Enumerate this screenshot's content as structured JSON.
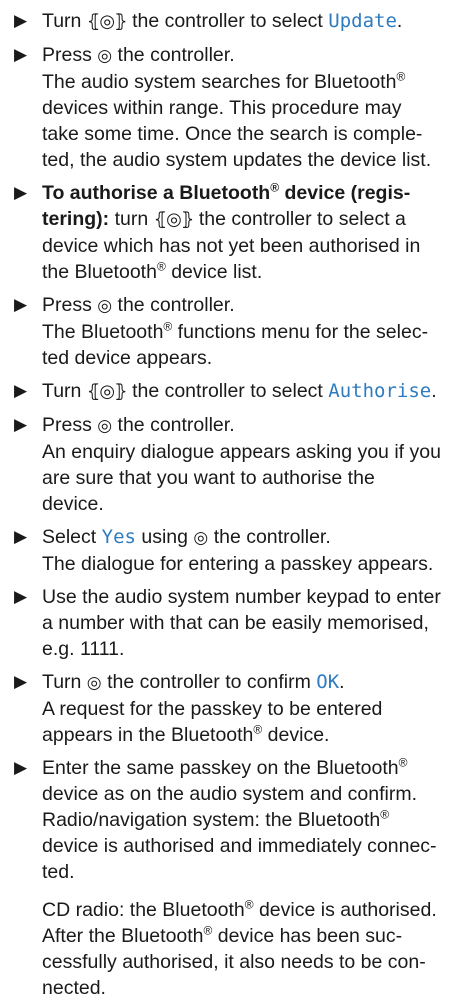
{
  "symbols": {
    "bullet": "▶",
    "press": "◎",
    "turn": "⦃◎⦄",
    "reg": "®"
  },
  "colors": {
    "ui_text": "#2e7bbf"
  },
  "steps": [
    {
      "l1a": "Turn",
      "l1b": "the controller to select",
      "ui": "Update",
      "l1end": "."
    },
    {
      "l1a": "Press",
      "l1b": "the controller.",
      "l2": "The audio system searches for Bluetooth",
      "l3": "devices within range. This procedure may",
      "l4": "take some time. Once the search is comple-",
      "l5": "ted, the audio system updates the device list."
    },
    {
      "b1": "To authorise a Bluetooth",
      "b1b": " device (regis-",
      "b2": "tering):",
      "l2b": "turn",
      "l2c": "the controller to select a",
      "l3": "device which has not yet been authorised in",
      "l4a": "the Bluetooth",
      "l4b": " device list."
    },
    {
      "l1a": "Press",
      "l1b": "the controller.",
      "l2a": "The Bluetooth",
      "l2b": " functions menu for the selec-",
      "l3": "ted device appears."
    },
    {
      "l1a": "Turn",
      "l1b": "the controller to select",
      "ui": "Authorise",
      "l1end": "."
    },
    {
      "l1a": "Press",
      "l1b": "the controller.",
      "l2": "An enquiry dialogue appears asking you if you",
      "l3": "are sure that you want to authorise the",
      "l4": "device."
    },
    {
      "l1a": "Select",
      "ui": "Yes",
      "l1b": "using",
      "l1c": "the controller.",
      "l2": "The dialogue for entering a passkey appears."
    },
    {
      "l1": "Use the audio system number keypad to enter",
      "l2": "a number with that can be easily memorised,",
      "l3": "e.g. 1111."
    },
    {
      "l1a": "Turn",
      "l1b": "the controller to confirm",
      "ui": "OK",
      "l1end": ".",
      "l2": "A request for the passkey to be entered",
      "l3a": "appears in the Bluetooth",
      "l3b": " device."
    },
    {
      "l1a": "Enter the same passkey on the Bluetooth",
      "l2": "device as on the audio system and confirm.",
      "l3a": "Radio/navigation system: the Bluetooth",
      "l4": "device is authorised and immediately connec-",
      "l5": "ted."
    }
  ],
  "note": {
    "l1a": "CD radio: the Bluetooth",
    "l1b": " device is authorised.",
    "l2a": "After the Bluetooth",
    "l2b": " device has been suc-",
    "l3": "cessfully authorised, it also needs to be con-",
    "l4": "nected."
  }
}
